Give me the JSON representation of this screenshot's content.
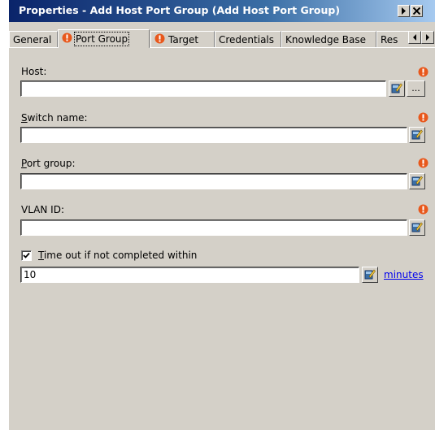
{
  "window": {
    "title": "Properties - Add Host Port Group (Add Host Port Group)"
  },
  "tabs": [
    {
      "label": "General",
      "has_error_icon": false
    },
    {
      "label": "Port Group",
      "has_error_icon": true,
      "active": true
    },
    {
      "label": "Target",
      "has_error_icon": true
    },
    {
      "label": "Credentials",
      "has_error_icon": false
    },
    {
      "label": "Knowledge Base",
      "has_error_icon": false
    },
    {
      "label": "Res",
      "has_error_icon": false
    }
  ],
  "fields": {
    "host": {
      "label": "Host:",
      "value": ""
    },
    "switch_name": {
      "label": "Switch name:",
      "value": ""
    },
    "port_group": {
      "label": "Port group:",
      "value": ""
    },
    "vlan_id": {
      "label": "VLAN ID:",
      "value": ""
    }
  },
  "timeout": {
    "checkbox_label": "Time out if not completed within",
    "checked": true,
    "value": "10",
    "unit_link": "minutes"
  },
  "buttons": {
    "browse_label": "..."
  },
  "colors": {
    "title_gradient_start": "#0a246a",
    "title_gradient_end": "#a6caf0",
    "error_icon": "#e8581c",
    "panel_bg": "#d4d0c8",
    "link": "#0000ee"
  },
  "icons": {
    "required": "error-icon",
    "edit": "edit-property-icon"
  }
}
